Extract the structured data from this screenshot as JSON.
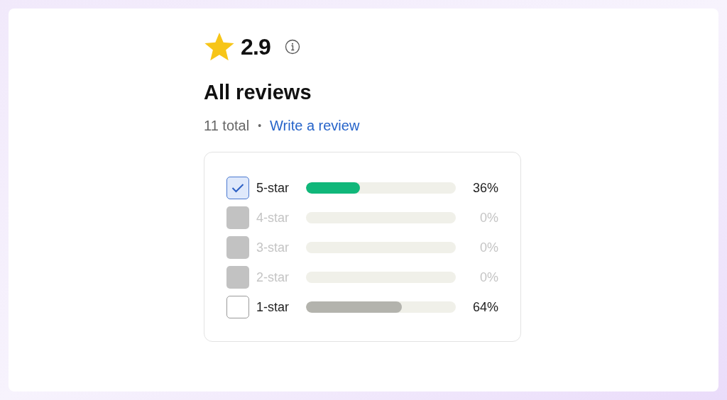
{
  "rating": {
    "value": "2.9"
  },
  "heading": "All reviews",
  "summary": {
    "total": "11 total",
    "separator": "•",
    "link": "Write a review"
  },
  "filters": [
    {
      "label": "5-star",
      "checked": true,
      "disabled": false,
      "level": 0.36,
      "reading": "36%"
    },
    {
      "label": "4-star",
      "checked": false,
      "disabled": true,
      "level": 0,
      "reading": "0%"
    },
    {
      "label": "3-star",
      "checked": false,
      "disabled": true,
      "level": 0,
      "reading": "0%"
    },
    {
      "label": "2-star",
      "checked": false,
      "disabled": true,
      "level": 0,
      "reading": "0%"
    },
    {
      "label": "1-star",
      "checked": false,
      "disabled": false,
      "level": 0.64,
      "reading": "64%"
    }
  ]
}
